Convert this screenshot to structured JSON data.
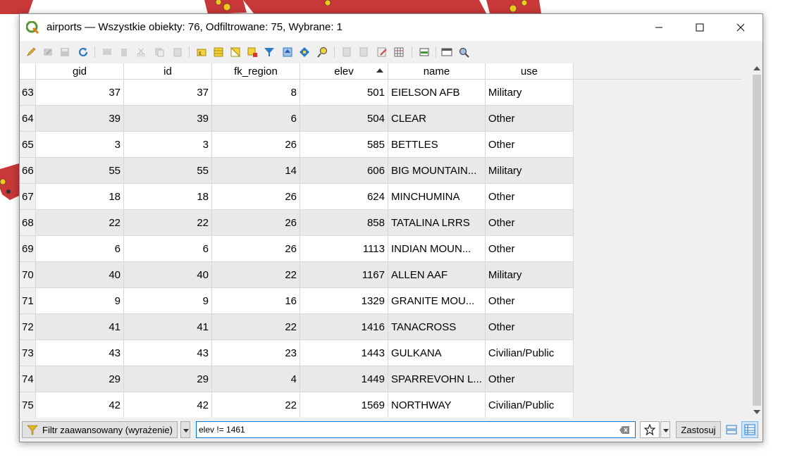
{
  "window": {
    "title": "airports — Wszystkie obiekty: 76, Odfiltrowane: 75, Wybrane: 1"
  },
  "colors": {
    "map_fill": "#c83838",
    "map_point": "#f2c91a",
    "row_alt": "#e9e9e7",
    "accent_border": "#0078d7"
  },
  "toolbar": {
    "icons": [
      "pencil-icon",
      "multi-edit-icon",
      "save-edits-icon",
      "reload-icon",
      "add-feature-icon",
      "delete-feature-icon",
      "cut-icon",
      "copy-icon",
      "paste-icon",
      "select-expression-icon",
      "select-all-icon",
      "invert-selection-icon",
      "deselect-all-icon",
      "filter-selected-icon",
      "move-selection-top-icon",
      "pan-to-selection-icon",
      "zoom-to-selection-icon",
      "new-field-icon",
      "delete-field-icon",
      "edit-field-icon",
      "field-calculator-icon",
      "conditional-formatting-icon",
      "dock-icon",
      "actions-icon"
    ]
  },
  "table": {
    "columns": [
      "gid",
      "id",
      "fk_region",
      "elev",
      "name",
      "use"
    ],
    "sorted_column": "elev",
    "rows": [
      {
        "rownum": "63",
        "gid": "37",
        "id": "37",
        "fk_region": "8",
        "elev": "501",
        "name": "EIELSON AFB",
        "use": "Military"
      },
      {
        "rownum": "64",
        "gid": "39",
        "id": "39",
        "fk_region": "6",
        "elev": "504",
        "name": "CLEAR",
        "use": "Other"
      },
      {
        "rownum": "65",
        "gid": "3",
        "id": "3",
        "fk_region": "26",
        "elev": "585",
        "name": "BETTLES",
        "use": "Other"
      },
      {
        "rownum": "66",
        "gid": "55",
        "id": "55",
        "fk_region": "14",
        "elev": "606",
        "name": "BIG MOUNTAIN...",
        "use": "Military"
      },
      {
        "rownum": "67",
        "gid": "18",
        "id": "18",
        "fk_region": "26",
        "elev": "624",
        "name": "MINCHUMINA",
        "use": "Other"
      },
      {
        "rownum": "68",
        "gid": "22",
        "id": "22",
        "fk_region": "26",
        "elev": "858",
        "name": "TATALINA LRRS",
        "use": "Other"
      },
      {
        "rownum": "69",
        "gid": "6",
        "id": "6",
        "fk_region": "26",
        "elev": "1113",
        "name": "INDIAN MOUN...",
        "use": "Other"
      },
      {
        "rownum": "70",
        "gid": "40",
        "id": "40",
        "fk_region": "22",
        "elev": "1167",
        "name": "ALLEN AAF",
        "use": "Military"
      },
      {
        "rownum": "71",
        "gid": "9",
        "id": "9",
        "fk_region": "16",
        "elev": "1329",
        "name": "GRANITE MOU...",
        "use": "Other"
      },
      {
        "rownum": "72",
        "gid": "41",
        "id": "41",
        "fk_region": "22",
        "elev": "1416",
        "name": "TANACROSS",
        "use": "Other"
      },
      {
        "rownum": "73",
        "gid": "43",
        "id": "43",
        "fk_region": "23",
        "elev": "1443",
        "name": "GULKANA",
        "use": "Civilian/Public"
      },
      {
        "rownum": "74",
        "gid": "29",
        "id": "29",
        "fk_region": "4",
        "elev": "1449",
        "name": "SPARREVOHN L...",
        "use": "Other"
      },
      {
        "rownum": "75",
        "gid": "42",
        "id": "42",
        "fk_region": "22",
        "elev": "1569",
        "name": "NORTHWAY",
        "use": "Civilian/Public"
      }
    ]
  },
  "bottombar": {
    "filter_label": "Filtr zaawansowany (wyrażenie)",
    "expression": "elev != 1461",
    "apply_label": "Zastosuj"
  }
}
